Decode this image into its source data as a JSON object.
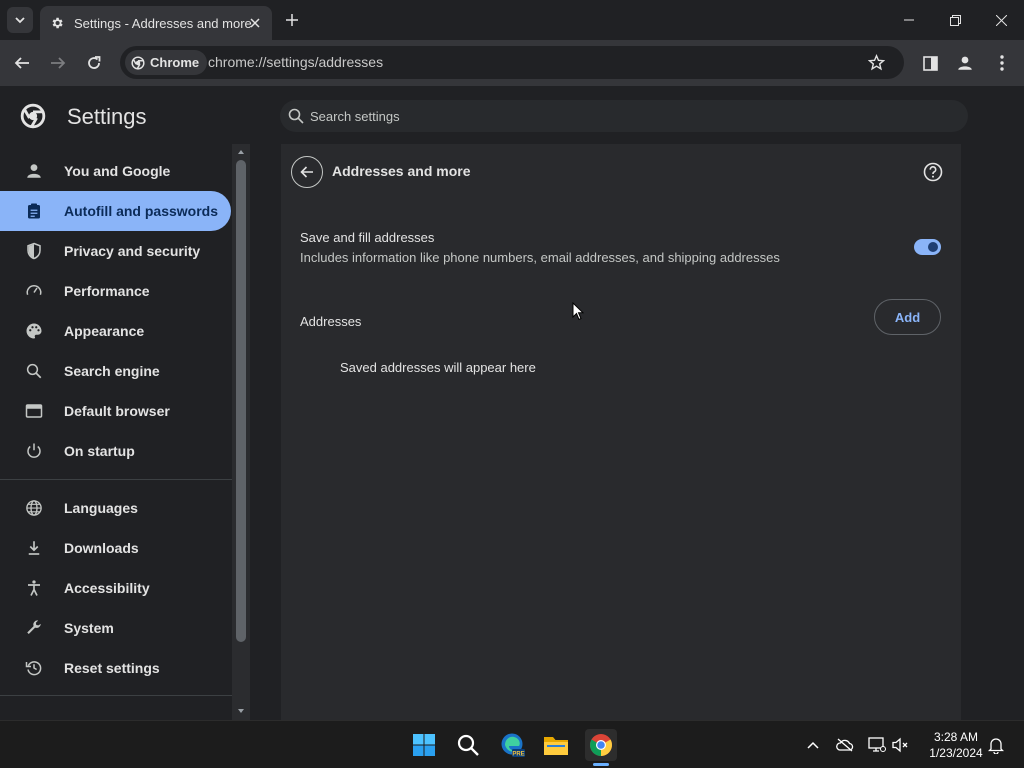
{
  "browser": {
    "tab_title": "Settings - Addresses and more",
    "chip_label": "Chrome",
    "url": "chrome://settings/addresses"
  },
  "settings": {
    "title": "Settings",
    "search_placeholder": "Search settings"
  },
  "sidebar": {
    "items": [
      {
        "label": "You and Google",
        "icon": "person-icon"
      },
      {
        "label": "Autofill and passwords",
        "icon": "clipboard-icon",
        "active": true
      },
      {
        "label": "Privacy and security",
        "icon": "shield-icon"
      },
      {
        "label": "Performance",
        "icon": "speedometer-icon"
      },
      {
        "label": "Appearance",
        "icon": "palette-icon"
      },
      {
        "label": "Search engine",
        "icon": "search-icon"
      },
      {
        "label": "Default browser",
        "icon": "browser-window-icon"
      },
      {
        "label": "On startup",
        "icon": "power-icon"
      },
      {
        "label": "Languages",
        "icon": "globe-icon"
      },
      {
        "label": "Downloads",
        "icon": "download-icon"
      },
      {
        "label": "Accessibility",
        "icon": "accessibility-icon"
      },
      {
        "label": "System",
        "icon": "wrench-icon"
      },
      {
        "label": "Reset settings",
        "icon": "history-icon"
      }
    ]
  },
  "main": {
    "title": "Addresses and more",
    "save_fill": {
      "title": "Save and fill addresses",
      "description": "Includes information like phone numbers, email addresses, and shipping addresses",
      "enabled": true
    },
    "addresses_heading": "Addresses",
    "add_label": "Add",
    "empty_message": "Saved addresses will appear here"
  },
  "taskbar": {
    "time": "3:28 AM",
    "date": "1/23/2024"
  },
  "colors": {
    "accent": "#8ab4f8",
    "background": "#202124",
    "panel": "#292a2d"
  }
}
